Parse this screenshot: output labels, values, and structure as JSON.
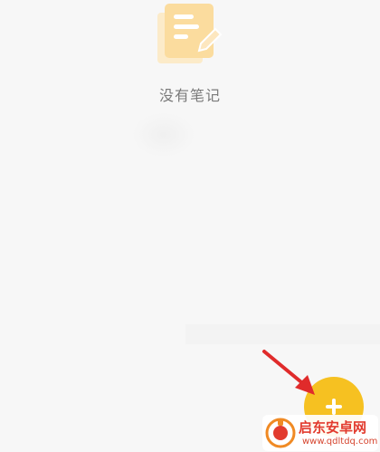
{
  "empty_state": {
    "icon": "note-edit-icon",
    "message": "没有笔记"
  },
  "fab": {
    "icon": "add-icon",
    "color": "#f6c121"
  },
  "annotation": {
    "icon": "arrow-icon",
    "color": "#e02b2b"
  },
  "watermark": {
    "title": "启东安卓网",
    "url": "www.qdltdq.com",
    "icon": "watermark-logo-icon"
  }
}
